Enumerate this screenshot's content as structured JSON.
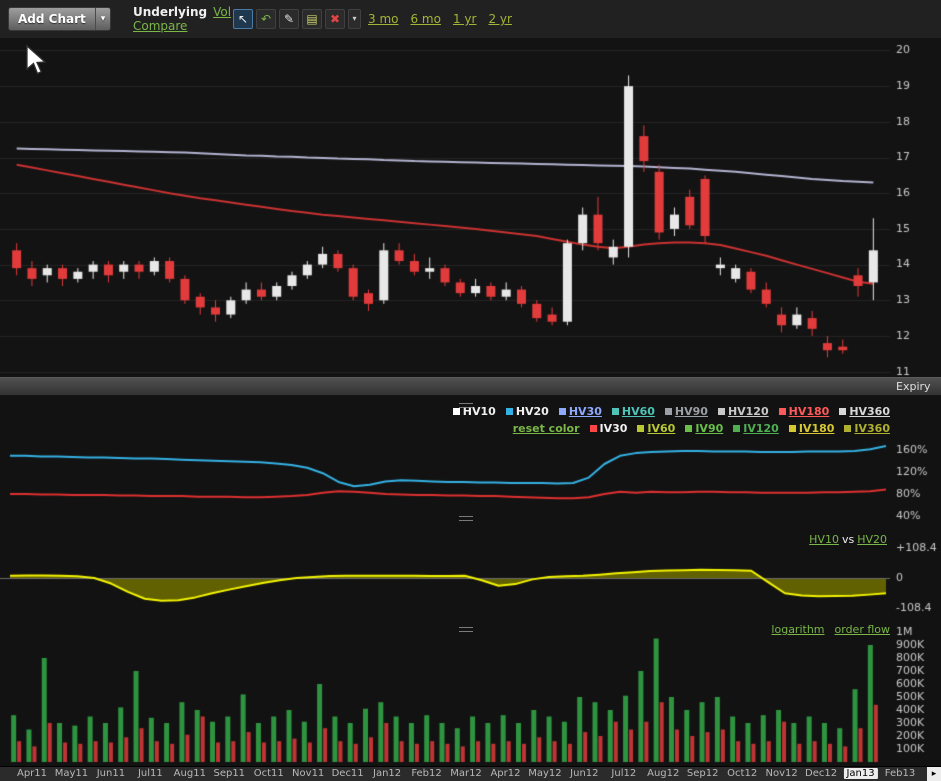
{
  "toolbar": {
    "add_chart_label": "Add Chart",
    "add_chart_arrow": "▾",
    "underlying_label": "Underlying",
    "vol_label": "Vol",
    "compare_label": "Compare",
    "ranges": [
      "3 mo",
      "6 mo",
      "1 yr",
      "2 yr"
    ],
    "icons": [
      {
        "name": "pointer-tool",
        "glyph": "↖",
        "color": "#f0f0f0",
        "selected": true
      },
      {
        "name": "undo-tool",
        "glyph": "↶",
        "color": "#7ab648",
        "selected": false
      },
      {
        "name": "draw-tool",
        "glyph": "✎",
        "color": "#e0e0e0",
        "selected": false
      },
      {
        "name": "notes-tool",
        "glyph": "▤",
        "color": "#cfd36a",
        "selected": false
      },
      {
        "name": "delete-tool",
        "glyph": "✖",
        "color": "#e04545",
        "selected": false
      },
      {
        "name": "tools-dropdown",
        "glyph": "▾",
        "color": "#cccccc",
        "selected": false
      }
    ]
  },
  "expiry_bar": {
    "label": "Expiry"
  },
  "legend": {
    "rows": [
      {
        "items": [
          {
            "label": "HV10",
            "color": "#ffffff",
            "active": true
          },
          {
            "label": "HV20",
            "color": "#35b2e5",
            "active": true
          },
          {
            "label": "HV30",
            "color": "#8fa8ff",
            "active": false
          },
          {
            "label": "HV60",
            "color": "#4fc3b8",
            "active": false
          },
          {
            "label": "HV90",
            "color": "#9aa0a6",
            "active": false
          },
          {
            "label": "HV120",
            "color": "#c8c8c8",
            "active": false
          },
          {
            "label": "HV180",
            "color": "#ff5a5a",
            "active": false
          },
          {
            "label": "HV360",
            "color": "#d8d8d8",
            "active": false
          }
        ]
      },
      {
        "items": [
          {
            "label": "reset color",
            "color": "#7ab648",
            "active": false,
            "no_marker": true
          },
          {
            "label": "IV30",
            "color": "#ff4545",
            "active": true
          },
          {
            "label": "IV60",
            "color": "#b8c832",
            "active": false
          },
          {
            "label": "IV90",
            "color": "#6abf4b",
            "active": false
          },
          {
            "label": "IV120",
            "color": "#4fae52",
            "active": false
          },
          {
            "label": "IV180",
            "color": "#d6c832",
            "active": false
          },
          {
            "label": "IV360",
            "color": "#b0b030",
            "active": false
          }
        ]
      }
    ]
  },
  "compare_header": {
    "left": "HV10",
    "mid": "vs",
    "right": "HV20"
  },
  "volume_header": {
    "logarithm": "logarithm",
    "order_flow": "order flow"
  },
  "x_axis": {
    "months": [
      "Apr11",
      "May11",
      "Jun11",
      "Jul11",
      "Aug11",
      "Sep11",
      "Oct11",
      "Nov11",
      "Dec11",
      "Jan12",
      "Feb12",
      "Mar12",
      "Apr12",
      "May12",
      "Jun12",
      "Jul12",
      "Aug12",
      "Sep12",
      "Oct12",
      "Nov12",
      "Dec12",
      "Jan13",
      "Feb13"
    ],
    "selected": "Jan13",
    "arrow": "▸"
  },
  "chart_data": [
    {
      "type": "candlestick",
      "name": "underlying-price",
      "ylabels": [
        "20",
        "19",
        "18",
        "17",
        "16",
        "15",
        "14",
        "13",
        "12",
        "11"
      ],
      "yticks": [
        20,
        19,
        18,
        17,
        16,
        15,
        14,
        13,
        12,
        11
      ],
      "ylim": [
        10.85,
        20.35
      ],
      "up_color": "#e8e8e8",
      "down_color": "#e23b3b",
      "candles": [
        [
          14.4,
          14.6,
          13.7,
          13.9
        ],
        [
          13.9,
          14.1,
          13.4,
          13.6
        ],
        [
          13.7,
          14.0,
          13.5,
          13.9
        ],
        [
          13.9,
          14.0,
          13.4,
          13.6
        ],
        [
          13.6,
          13.9,
          13.5,
          13.8
        ],
        [
          13.8,
          14.1,
          13.6,
          14.0
        ],
        [
          14.0,
          14.1,
          13.5,
          13.7
        ],
        [
          13.8,
          14.1,
          13.6,
          14.0
        ],
        [
          14.0,
          14.1,
          13.6,
          13.8
        ],
        [
          13.8,
          14.2,
          13.7,
          14.1
        ],
        [
          14.1,
          14.2,
          13.5,
          13.6
        ],
        [
          13.6,
          13.7,
          12.9,
          13.0
        ],
        [
          13.1,
          13.2,
          12.6,
          12.8
        ],
        [
          12.8,
          13.0,
          12.4,
          12.6
        ],
        [
          12.6,
          13.1,
          12.5,
          13.0
        ],
        [
          13.0,
          13.5,
          12.9,
          13.3
        ],
        [
          13.3,
          13.5,
          13.0,
          13.1
        ],
        [
          13.1,
          13.5,
          13.0,
          13.4
        ],
        [
          13.4,
          13.8,
          13.3,
          13.7
        ],
        [
          13.7,
          14.1,
          13.6,
          14.0
        ],
        [
          14.0,
          14.5,
          13.9,
          14.3
        ],
        [
          14.3,
          14.4,
          13.8,
          13.9
        ],
        [
          13.9,
          14.0,
          13.0,
          13.1
        ],
        [
          13.2,
          13.3,
          12.7,
          12.9
        ],
        [
          13.0,
          14.6,
          12.9,
          14.4
        ],
        [
          14.4,
          14.6,
          14.0,
          14.1
        ],
        [
          14.1,
          14.3,
          13.7,
          13.8
        ],
        [
          13.8,
          14.2,
          13.6,
          13.9
        ],
        [
          13.9,
          14.0,
          13.4,
          13.5
        ],
        [
          13.5,
          13.6,
          13.1,
          13.2
        ],
        [
          13.2,
          13.6,
          13.1,
          13.4
        ],
        [
          13.4,
          13.5,
          13.0,
          13.1
        ],
        [
          13.1,
          13.5,
          13.0,
          13.3
        ],
        [
          13.3,
          13.4,
          12.8,
          12.9
        ],
        [
          12.9,
          13.0,
          12.4,
          12.5
        ],
        [
          12.6,
          12.8,
          12.3,
          12.4
        ],
        [
          12.4,
          14.7,
          12.3,
          14.6
        ],
        [
          14.6,
          15.6,
          14.4,
          15.4
        ],
        [
          15.4,
          15.9,
          14.4,
          14.6
        ],
        [
          14.2,
          14.7,
          14.0,
          14.5
        ],
        [
          14.5,
          19.3,
          14.2,
          19.0
        ],
        [
          17.6,
          17.9,
          16.6,
          16.9
        ],
        [
          16.6,
          16.8,
          14.7,
          14.9
        ],
        [
          15.0,
          15.6,
          14.8,
          15.4
        ],
        [
          15.9,
          16.1,
          15.0,
          15.1
        ],
        [
          16.4,
          16.5,
          14.6,
          14.8
        ],
        [
          13.9,
          14.2,
          13.7,
          14.0
        ],
        [
          13.6,
          14.0,
          13.5,
          13.9
        ],
        [
          13.8,
          13.9,
          13.2,
          13.3
        ],
        [
          13.3,
          13.5,
          12.8,
          12.9
        ],
        [
          12.6,
          12.8,
          12.1,
          12.3
        ],
        [
          12.3,
          12.8,
          12.2,
          12.6
        ],
        [
          12.5,
          12.7,
          12.0,
          12.2
        ],
        [
          11.8,
          12.0,
          11.4,
          11.6
        ],
        [
          11.7,
          11.9,
          11.5,
          11.6
        ],
        [
          13.7,
          13.9,
          13.1,
          13.4
        ],
        [
          13.5,
          15.3,
          13.0,
          14.4
        ]
      ],
      "ma": [
        {
          "name": "sma-slow",
          "color": "#b4b4d2",
          "values": [
            17.25,
            17.24,
            17.23,
            17.22,
            17.21,
            17.2,
            17.19,
            17.18,
            17.17,
            17.16,
            17.15,
            17.14,
            17.12,
            17.1,
            17.08,
            17.06,
            17.05,
            17.03,
            17.02,
            17.0,
            16.99,
            16.97,
            16.96,
            16.95,
            16.93,
            16.92,
            16.9,
            16.89,
            16.88,
            16.87,
            16.86,
            16.85,
            16.84,
            16.83,
            16.82,
            16.81,
            16.8,
            16.79,
            16.78,
            16.77,
            16.76,
            16.75,
            16.73,
            16.71,
            16.69,
            16.66,
            16.63,
            16.6,
            16.56,
            16.52,
            16.48,
            16.44,
            16.4,
            16.37,
            16.34,
            16.32,
            16.3
          ]
        },
        {
          "name": "sma-fast",
          "color": "#cc3232",
          "values": [
            16.8,
            16.72,
            16.64,
            16.56,
            16.48,
            16.4,
            16.32,
            16.24,
            16.16,
            16.08,
            16.0,
            15.93,
            15.86,
            15.8,
            15.74,
            15.68,
            15.62,
            15.56,
            15.5,
            15.45,
            15.4,
            15.36,
            15.32,
            15.28,
            15.24,
            15.2,
            15.16,
            15.12,
            15.08,
            15.04,
            15.0,
            14.95,
            14.9,
            14.85,
            14.8,
            14.72,
            14.64,
            14.56,
            14.5,
            14.46,
            14.5,
            14.56,
            14.6,
            14.62,
            14.62,
            14.6,
            14.55,
            14.45,
            14.35,
            14.25,
            14.12,
            14.0,
            13.88,
            13.76,
            13.64,
            13.52,
            13.46
          ]
        }
      ]
    },
    {
      "type": "line",
      "name": "historical-implied-volatility",
      "ylabels": [
        "160%",
        "120%",
        "80%",
        "40%"
      ],
      "yticks": [
        160,
        120,
        80,
        40
      ],
      "ylim": [
        10,
        260
      ],
      "series": [
        {
          "name": "HV20",
          "color": "#35b2e5",
          "values": [
            150,
            150,
            149,
            149,
            148,
            147,
            147,
            146,
            145,
            145,
            144,
            143,
            142,
            141,
            140,
            139,
            138,
            136,
            133,
            128,
            118,
            102,
            94,
            97,
            103,
            105,
            104,
            103,
            102,
            102,
            101,
            101,
            100,
            100,
            100,
            99,
            100,
            110,
            135,
            150,
            155,
            157,
            158,
            159,
            159,
            158,
            158,
            158,
            157,
            157,
            157,
            158,
            158,
            158,
            159,
            162,
            168
          ]
        },
        {
          "name": "IV30",
          "color": "#e03030",
          "values": [
            80,
            80,
            79,
            79,
            78,
            78,
            78,
            77,
            77,
            76,
            76,
            76,
            75,
            75,
            75,
            74,
            74,
            75,
            76,
            78,
            82,
            85,
            84,
            82,
            80,
            79,
            78,
            78,
            77,
            77,
            76,
            76,
            75,
            74,
            73,
            72,
            72,
            74,
            80,
            84,
            82,
            84,
            83,
            83,
            84,
            84,
            83,
            83,
            82,
            82,
            82,
            82,
            83,
            83,
            84,
            85,
            88
          ]
        }
      ]
    },
    {
      "type": "area",
      "name": "hv10-vs-hv20-spread",
      "ylabels": [
        "+108.4",
        "0",
        "-108.4"
      ],
      "yticks": [
        108.4,
        0,
        -108.4
      ],
      "ylim": [
        -166,
        166
      ],
      "series": [
        {
          "name": "HV10-HV20",
          "color": "#f5f500",
          "fill": "#6a6a00",
          "values": [
            8,
            9,
            9,
            8,
            6,
            0,
            -20,
            -50,
            -75,
            -82,
            -80,
            -70,
            -55,
            -42,
            -30,
            -18,
            -8,
            0,
            4,
            7,
            8,
            8,
            8,
            8,
            8,
            7,
            7,
            8,
            -8,
            -28,
            -22,
            -5,
            4,
            6,
            8,
            12,
            17,
            21,
            25,
            27,
            28,
            30,
            29,
            28,
            26,
            -15,
            -55,
            -63,
            -66,
            -65,
            -64,
            -60,
            -55
          ]
        }
      ]
    },
    {
      "type": "bar",
      "name": "volume-order-flow",
      "ylabels": [
        "1M",
        "900K",
        "800K",
        "700K",
        "600K",
        "500K",
        "400K",
        "300K",
        "200K",
        "100K"
      ],
      "yticks": [
        1000,
        900,
        800,
        700,
        600,
        500,
        400,
        300,
        200,
        100
      ],
      "ylim": [
        0,
        1062
      ],
      "series": [
        {
          "name": "buy-volume",
          "color": "#2e9440",
          "values": [
            360,
            250,
            800,
            300,
            280,
            350,
            300,
            420,
            700,
            340,
            300,
            460,
            400,
            310,
            350,
            520,
            300,
            350,
            400,
            310,
            600,
            350,
            300,
            410,
            460,
            350,
            300,
            360,
            300,
            260,
            350,
            300,
            360,
            300,
            400,
            350,
            310,
            500,
            460,
            400,
            510,
            700,
            950,
            500,
            400,
            460,
            500,
            350,
            300,
            360,
            400,
            300,
            350,
            300,
            260,
            560,
            900
          ]
        },
        {
          "name": "sell-volume",
          "color": "#c03434",
          "values": [
            160,
            120,
            300,
            150,
            140,
            160,
            150,
            190,
            260,
            160,
            140,
            210,
            350,
            150,
            160,
            230,
            150,
            160,
            180,
            150,
            260,
            160,
            140,
            190,
            300,
            160,
            140,
            160,
            140,
            120,
            160,
            140,
            160,
            140,
            190,
            160,
            140,
            230,
            200,
            310,
            250,
            310,
            460,
            250,
            200,
            230,
            250,
            160,
            140,
            160,
            310,
            140,
            160,
            140,
            120,
            260,
            440
          ]
        }
      ]
    }
  ]
}
